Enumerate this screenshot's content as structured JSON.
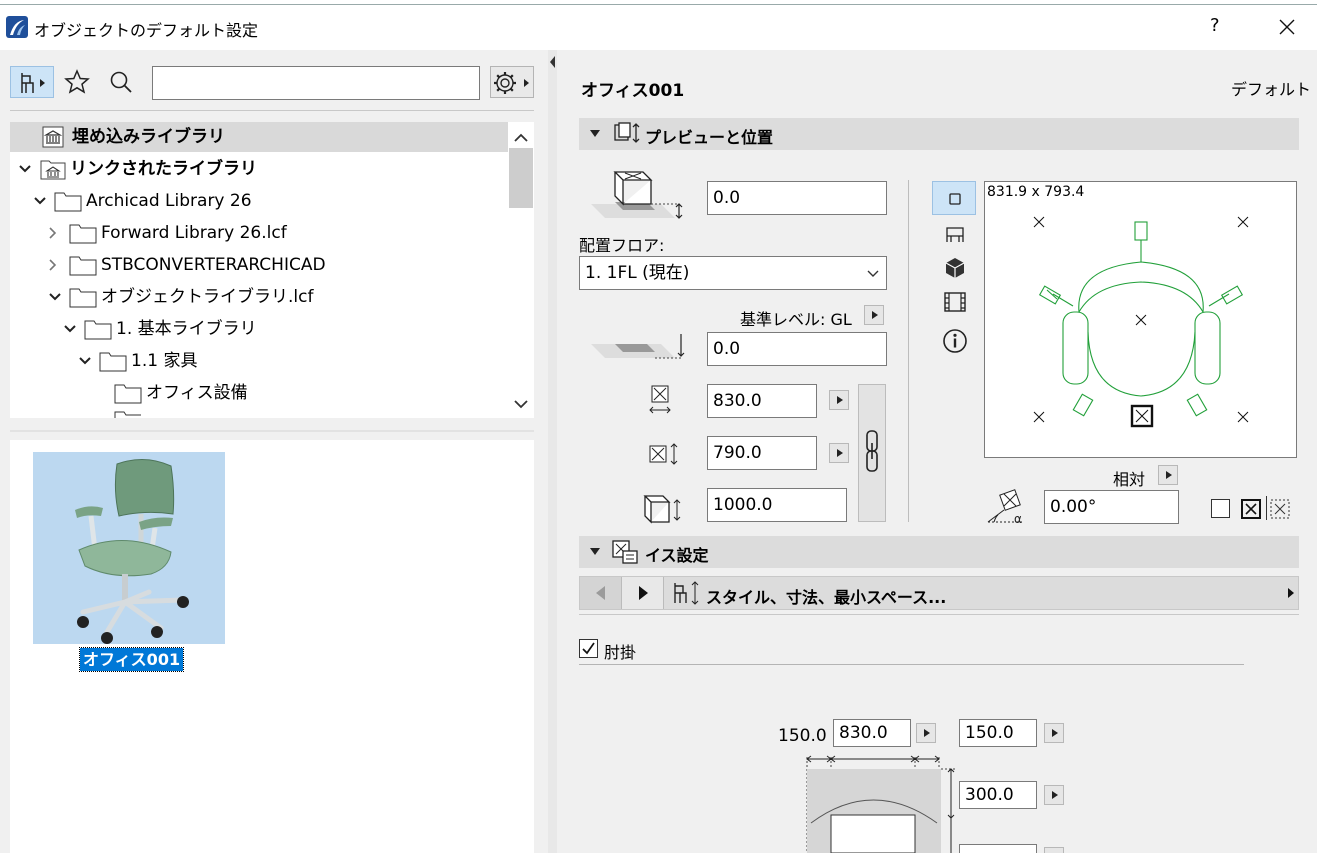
{
  "window": {
    "title": "オブジェクトのデフォルト設定",
    "help_label": "?",
    "close_label": "✕"
  },
  "library": {
    "search_value": "",
    "tree": [
      {
        "label": "埋め込みライブラリ",
        "bold": true,
        "selected": true
      },
      {
        "label": "リンクされたライブラリ",
        "bold": true
      },
      {
        "label": "Archicad Library 26"
      },
      {
        "label": "Forward Library 26.lcf"
      },
      {
        "label": "STBCONVERTERARCHICAD"
      },
      {
        "label": "オブジェクトライブラリ.lcf"
      },
      {
        "label": "1. 基本ライブラリ"
      },
      {
        "label": "1.1 家具"
      },
      {
        "label": "オフィス設備"
      }
    ],
    "selected_item_label": "オフィス001"
  },
  "object": {
    "name": "オフィス001",
    "default_label": "デフォルト"
  },
  "preview_section": {
    "title": "プレビューと位置",
    "elevation_value": "0.0",
    "floor_label": "配置フロア:",
    "floor_value": "1. 1FL (現在)",
    "ref_level_label": "基準レベル: GL",
    "ref_elevation_value": "0.0",
    "width_value": "830.0",
    "depth_value": "790.0",
    "height_value": "1000.0",
    "preview_size": "831.9 x 793.4",
    "relative_label": "相対",
    "angle_value": "0.00°"
  },
  "chair_section": {
    "title": "イス設定",
    "page_title": "スタイル、寸法、最小スペース...",
    "armrest_label": "肘掛",
    "armrest_checked": true,
    "dim_left_label": "150.0",
    "dim_width_value": "830.0",
    "dim_right_value": "150.0",
    "dim_depth_value": "300.0"
  },
  "colors": {
    "accent": "#cde4f7",
    "selection": "#0078d7",
    "preview_line": "#22a03a"
  }
}
